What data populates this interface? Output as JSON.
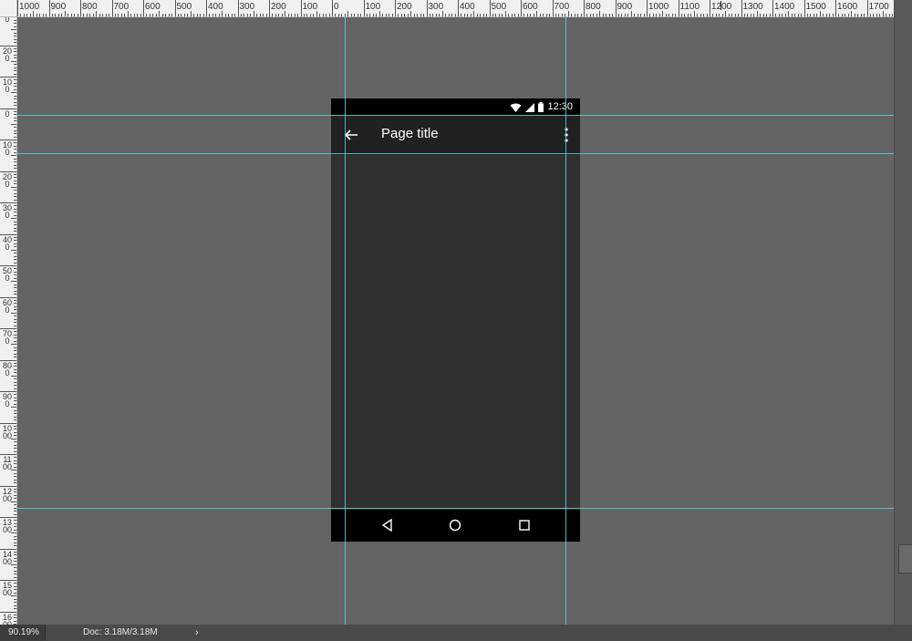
{
  "rulers": {
    "top_labels": [
      "1000",
      "900",
      "800",
      "700",
      "600",
      "500",
      "400",
      "300",
      "200",
      "100",
      "0",
      "100",
      "200",
      "300",
      "400",
      "500",
      "600",
      "700",
      "800",
      "900",
      "1000",
      "1100",
      "1200",
      "1300",
      "1400",
      "1500",
      "1600",
      "1700"
    ],
    "left_labels": [
      "0",
      "200",
      "100",
      "0",
      "100",
      "200",
      "300",
      "400",
      "500",
      "600",
      "700",
      "800",
      "900",
      "1000",
      "1100",
      "1200",
      "1300",
      "1400",
      "1500",
      "1600"
    ]
  },
  "phone": {
    "status_time": "12:30",
    "page_title": "Page title",
    "icons": {
      "wifi": "wifi-icon",
      "signal": "signal-icon",
      "battery": "battery-icon",
      "back": "arrow-back-icon",
      "overflow": "more-vert-icon",
      "nav_back": "nav-back-triangle-icon",
      "nav_home": "nav-home-circle-icon",
      "nav_recents": "nav-recents-square-icon"
    }
  },
  "footer": {
    "zoom": "90.19%",
    "doc_info": "Doc: 3.18M/3.18M",
    "expand_arrow": "›"
  },
  "colors": {
    "canvas_bg": "#646464",
    "guide": "#59d4d4",
    "phone_content": "#303030",
    "app_bar": "#212121",
    "status_bar": "#000000"
  }
}
